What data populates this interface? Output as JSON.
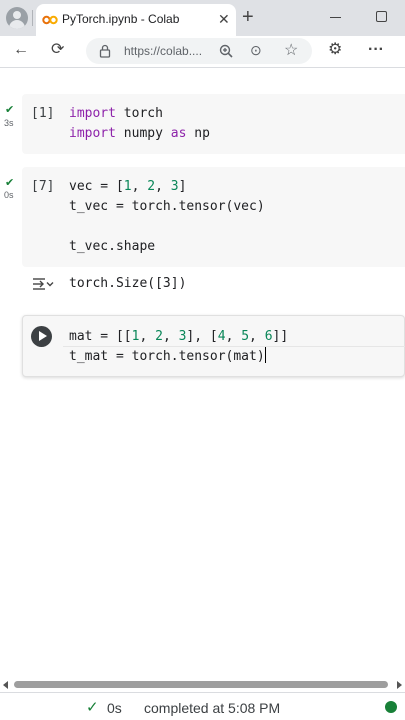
{
  "browser": {
    "tab_title": "PyTorch.ipynb - Colab",
    "tab_close": "✕",
    "new_tab": "+",
    "url": "https://colab....",
    "back": "←",
    "reload": "⟳",
    "more_menu": "···",
    "addr_more": "⊙",
    "star": "☆",
    "extensions": "⚙"
  },
  "cells": [
    {
      "exec_count": "[1]",
      "exec_time": "3s",
      "lines": [
        "import torch",
        "import numpy as np"
      ]
    },
    {
      "exec_count": "[7]",
      "exec_time": "0s",
      "lines": [
        "vec = [1, 2, 3]",
        "t_vec = torch.tensor(vec)",
        "",
        "t_vec.shape"
      ],
      "output": "torch.Size([3])"
    },
    {
      "lines": [
        "mat = [[1, 2, 3], [4, 5, 6]]",
        "t_mat = torch.tensor(mat)"
      ]
    }
  ],
  "status": {
    "time": "0s",
    "text": "completed at 5:08 PM"
  },
  "colors": {
    "keyword": "#8e24aa",
    "number": "#098658",
    "success": "#188038",
    "cell_bg": "#f7f7f7"
  }
}
